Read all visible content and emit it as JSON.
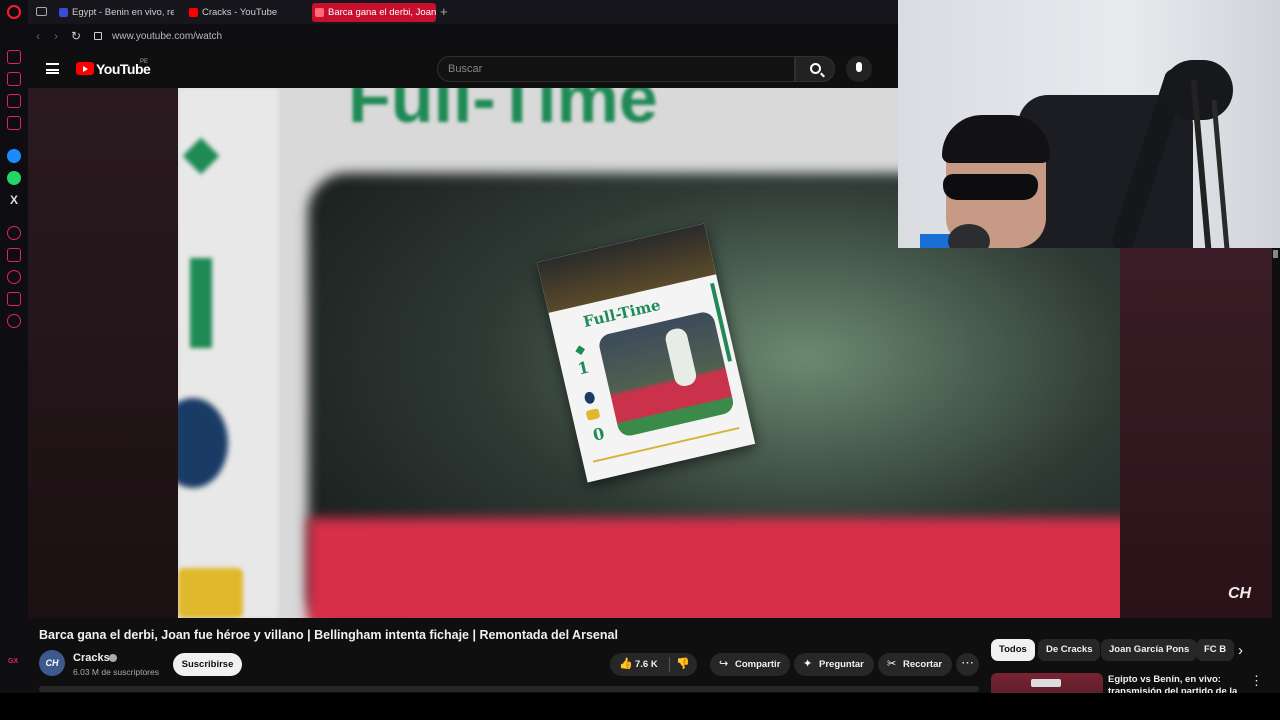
{
  "browser": {
    "tabs": [
      {
        "label": "Egypt - Benin en vivo, resu",
        "active": false
      },
      {
        "label": "Cracks - YouTube",
        "active": false
      },
      {
        "label": "Barca gana el derbi, Joan",
        "active": true
      }
    ],
    "url": "www.youtube.com/watch",
    "sidebar_bottom": "GX"
  },
  "youtube": {
    "logo_text": "YouTube",
    "region": "PE",
    "search_placeholder": "Buscar"
  },
  "video": {
    "overlay_title": "Full-Time",
    "card_title": "Full-Time",
    "score_home": "1",
    "score_away": "0",
    "watermark": "CH",
    "title": "Barca gana el derbi, Joan fue héroe y villano | Bellingham intenta fichaje | Remontada del Arsenal"
  },
  "channel": {
    "avatar_text": "CH",
    "name": "Cracks",
    "subscribers": "6.03 M de suscriptores",
    "subscribe_label": "Suscribirse"
  },
  "actions": {
    "likes": "7.6 K",
    "share": "Compartir",
    "ask": "Preguntar",
    "clip": "Recortar"
  },
  "chips": [
    "Todos",
    "De Cracks",
    "Joan García Pons",
    "FC B"
  ],
  "recommendation": {
    "title": "Egipto vs Benín, en vivo: transmisión del partido de la"
  },
  "colors": {
    "accent_red": "#ff0000",
    "opera_red": "#c8102e",
    "card_green": "#1f8a55"
  }
}
